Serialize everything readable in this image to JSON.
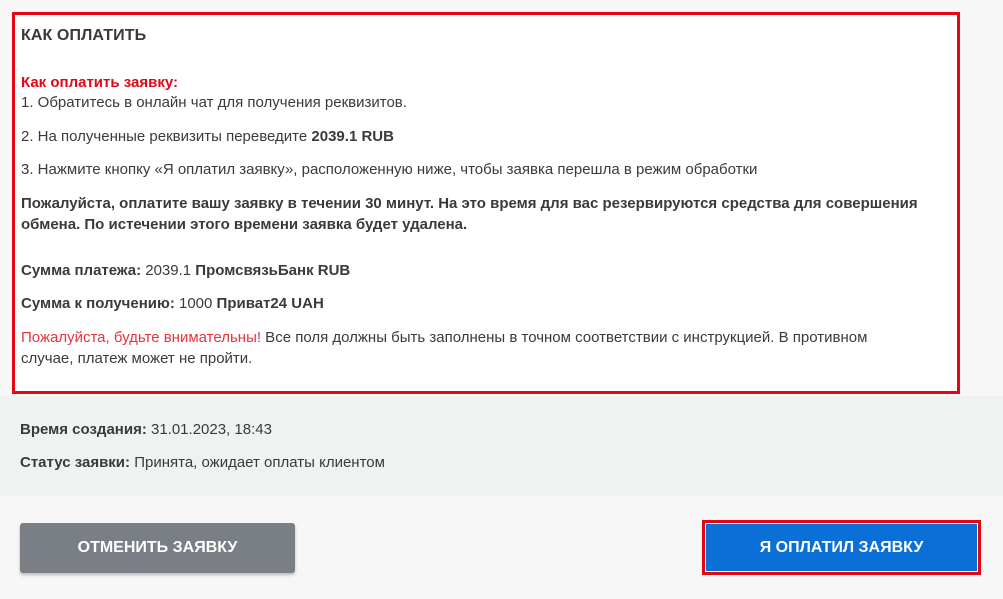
{
  "instructions": {
    "title": "КАК ОПЛАТИТЬ",
    "how_to_pay_heading": "Как оплатить заявку:",
    "step1": "1. Обратитесь в онлайн чат для получения реквизитов.",
    "step2_prefix": "2. На полученные реквизиты переведите ",
    "step2_amount": "2039.1 RUB",
    "step3": "3. Нажмите кнопку «Я оплатил заявку», расположенную ниже, чтобы заявка перешла в режим обработки",
    "notice": "Пожалуйста, оплатите вашу заявку в течении 30 минут. На это время для вас резервируются средства для совершения обмена. По истечении этого времени заявка будет удалена.",
    "payment_sum_label": "Сумма платежа:",
    "payment_sum_value": "2039.1",
    "payment_sum_currency": "ПромсвязьБанк RUB",
    "receive_sum_label": "Сумма к получению:",
    "receive_sum_value": "1000",
    "receive_sum_currency": "Приват24 UAH",
    "warning_red": "Пожалуйста, будьте внимательны!",
    "warning_text": " Все поля должны быть заполнены в точном соответствии с инструкцией. В противном случае, платеж может не пройти."
  },
  "meta": {
    "created_label": "Время создания:",
    "created_value": "31.01.2023, 18:43",
    "status_label": "Статус заявки:",
    "status_value": "Принята, ожидает оплаты клиентом"
  },
  "actions": {
    "cancel_label": "ОТМЕНИТЬ ЗАЯВКУ",
    "paid_label": "Я ОПЛАТИЛ ЗАЯВКУ"
  },
  "colors": {
    "accent_red": "#e30613",
    "primary_blue": "#0a6fd6",
    "cancel_gray": "#7a7e85"
  }
}
